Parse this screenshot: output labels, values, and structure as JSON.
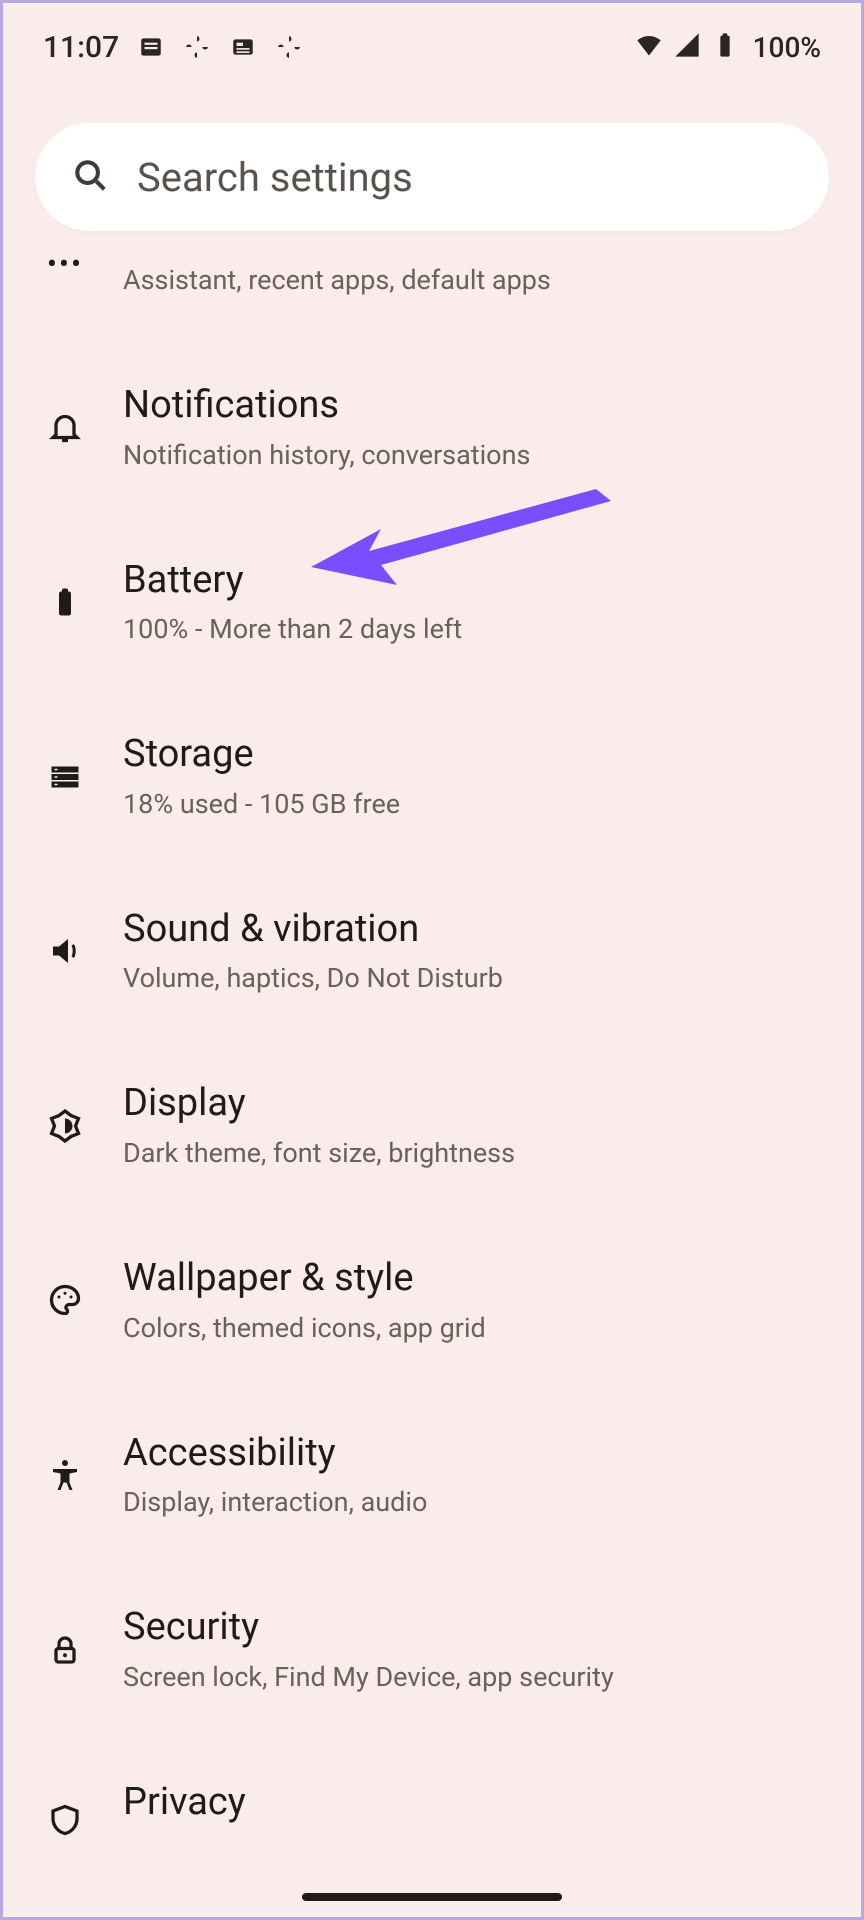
{
  "status": {
    "time": "11:07",
    "battery_text": "100%"
  },
  "search": {
    "placeholder": "Search settings"
  },
  "apps": {
    "subtitle": "Assistant, recent apps, default apps"
  },
  "items": [
    {
      "title": "Notifications",
      "subtitle": "Notification history, conversations"
    },
    {
      "title": "Battery",
      "subtitle": "100% - More than 2 days left"
    },
    {
      "title": "Storage",
      "subtitle": "18% used - 105 GB free"
    },
    {
      "title": "Sound & vibration",
      "subtitle": "Volume, haptics, Do Not Disturb"
    },
    {
      "title": "Display",
      "subtitle": "Dark theme, font size, brightness"
    },
    {
      "title": "Wallpaper & style",
      "subtitle": "Colors, themed icons, app grid"
    },
    {
      "title": "Accessibility",
      "subtitle": "Display, interaction, audio"
    },
    {
      "title": "Security",
      "subtitle": "Screen lock, Find My Device, app security"
    },
    {
      "title": "Privacy",
      "subtitle": ""
    }
  ],
  "annotation": {
    "color": "#7c4dff"
  }
}
